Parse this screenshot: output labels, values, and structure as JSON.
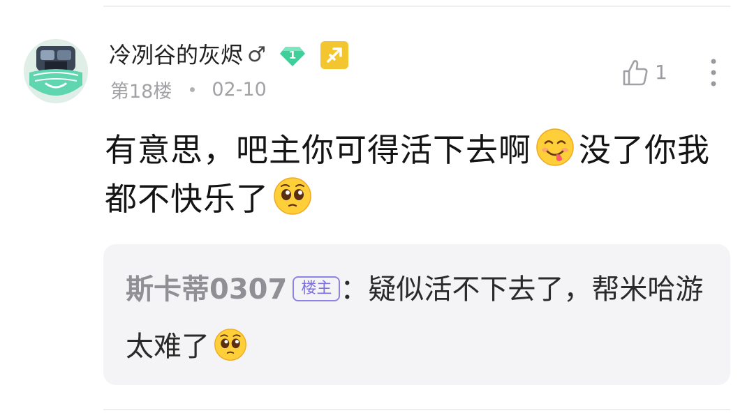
{
  "post": {
    "username": "冷冽谷的灰烬",
    "gender_symbol": "♂",
    "level": "1",
    "floor": "第18楼",
    "date": "02-10",
    "like_count": "1",
    "body_segments": [
      "有意思，吧主你可得活下去啊",
      "没了你我都不快乐了"
    ]
  },
  "quote": {
    "author": "斯卡蒂0307",
    "tag": "楼主",
    "colon": "：",
    "text": "疑似活不下去了，帮米哈游太难了"
  },
  "icons": {
    "avatar": "avatar-image",
    "level_badge": "diamond-level-icon",
    "zodiac_badge": "sagittarius-icon",
    "like": "thumbs-up-icon",
    "more": "more-vertical-icon",
    "emoji_1": "tongue-smile-emoji",
    "emoji_2": "pleading-face-emoji"
  },
  "colors": {
    "level_badge": "#3fcf9a",
    "zodiac_badge": "#f3c62f",
    "host_tag": "#7b6fe0",
    "quote_bg": "#f4f4f6"
  }
}
